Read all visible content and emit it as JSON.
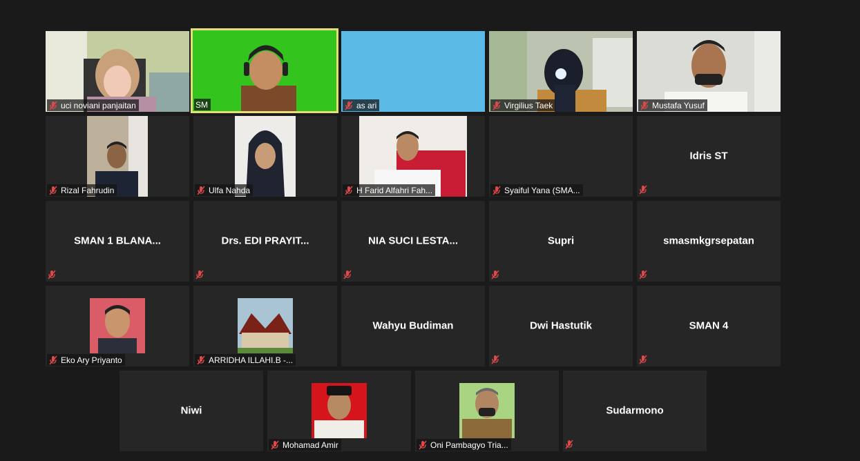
{
  "meeting": {
    "tiles": [
      {
        "name": "uci noviani panjaitan",
        "mode": "video",
        "bg": "#b9c79a"
      },
      {
        "name": "SM",
        "mode": "video",
        "bg": "#31c31c",
        "active": true,
        "unmuted": true
      },
      {
        "name": "as ari",
        "mode": "video",
        "bg": "#5cbbe6"
      },
      {
        "name": "Virgilius Taek",
        "mode": "video",
        "bg": "#b8bfae"
      },
      {
        "name": "Mustafa Yusuf",
        "mode": "video",
        "bg": "#d9dad5"
      },
      {
        "name": "Rizal Fahrudin",
        "mode": "portrait",
        "bg": "#b9ad95"
      },
      {
        "name": "Ulfa Nahda",
        "mode": "portrait",
        "bg": "#eceae6"
      },
      {
        "name": "H Farid Alfahri Fah...",
        "mode": "portrait",
        "bg": "#f1eeea"
      },
      {
        "name": "Syaiful Yana (SMA...",
        "mode": "blank"
      },
      {
        "name": "Idris ST",
        "mode": "text"
      },
      {
        "name": "SMAN 1 BLANA...",
        "mode": "text"
      },
      {
        "name": "Drs. EDI PRAYIT...",
        "mode": "text"
      },
      {
        "name": "NIA SUCI LESTA...",
        "mode": "text"
      },
      {
        "name": "Supri",
        "mode": "text"
      },
      {
        "name": "smasmkgrsepatan",
        "mode": "text"
      },
      {
        "name": "Eko Ary Priyanto",
        "mode": "photo",
        "bg": "#d85c64"
      },
      {
        "name": "ARRIDHA ILLAHI.B -...",
        "mode": "photo",
        "bg": "#a8c0cf"
      },
      {
        "name": "Wahyu Budiman",
        "mode": "text"
      },
      {
        "name": "Dwi Hastutik",
        "mode": "text"
      },
      {
        "name": "SMAN 4",
        "mode": "text"
      },
      {
        "name": "Niwi",
        "mode": "text"
      },
      {
        "name": "Mohamad Amir",
        "mode": "photo",
        "bg": "#d5141c"
      },
      {
        "name": "Oni Pambagyo Tria...",
        "mode": "photo",
        "bg": "#9ecf6f"
      },
      {
        "name": "Sudarmono",
        "mode": "text"
      }
    ]
  }
}
